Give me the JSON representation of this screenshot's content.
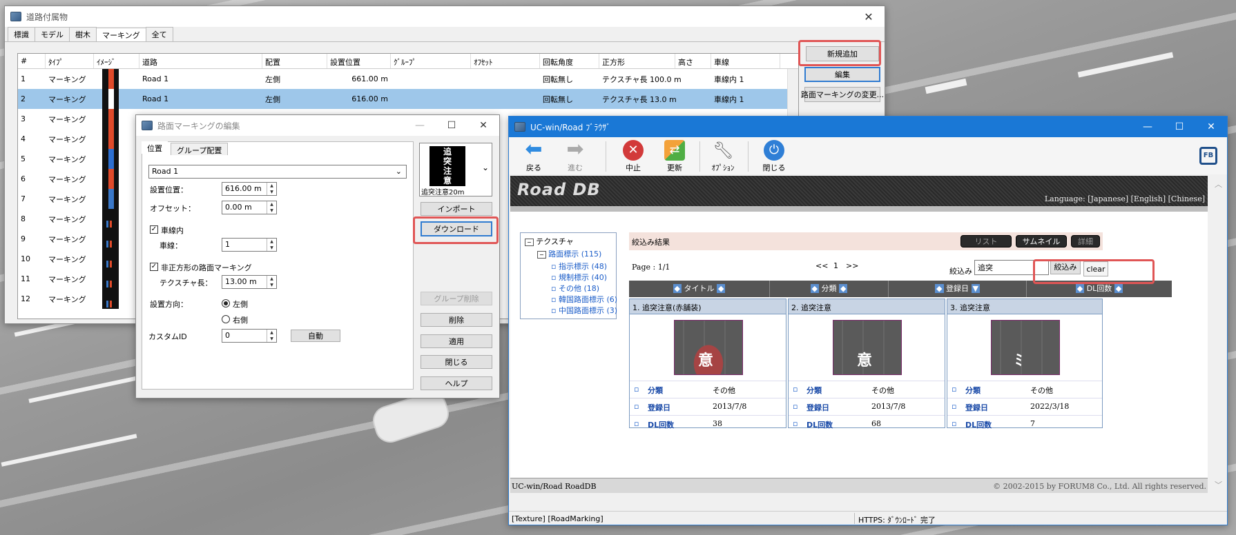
{
  "main_window": {
    "title": "道路付属物",
    "tabs": [
      "標識",
      "モデル",
      "樹木",
      "マーキング",
      "全て"
    ],
    "columns": [
      "#",
      "ﾀｲﾌﾟ",
      "ｲﾒｰｼﾞ",
      "道路",
      "配置",
      "設置位置",
      "ｸﾞﾙｰﾌﾟ",
      "ｵﾌｾｯﾄ",
      "回転角度",
      "正方形",
      "高さ",
      "車線"
    ],
    "rows": [
      {
        "num": "1",
        "type": "マーキング",
        "road": "Road 1",
        "place": "左側",
        "pos": "661.00 m",
        "rot": "回転無し",
        "square": "テクスチャ長 100.0 m",
        "lane": "車線内 1"
      },
      {
        "num": "2",
        "type": "マーキング",
        "road": "Road 1",
        "place": "左側",
        "pos": "616.00 m",
        "rot": "回転無し",
        "square": "テクスチャ長 13.0 m",
        "lane": "車線内 1"
      },
      {
        "num": "3",
        "type": "マーキング"
      },
      {
        "num": "4",
        "type": "マーキング"
      },
      {
        "num": "5",
        "type": "マーキング"
      },
      {
        "num": "6",
        "type": "マーキング"
      },
      {
        "num": "7",
        "type": "マーキング"
      },
      {
        "num": "8",
        "type": "マーキング"
      },
      {
        "num": "9",
        "type": "マーキング"
      },
      {
        "num": "10",
        "type": "マーキング"
      },
      {
        "num": "11",
        "type": "マーキング"
      },
      {
        "num": "12",
        "type": "マーキング"
      }
    ],
    "buttons": {
      "new": "新規追加",
      "edit": "編集",
      "change": "路面マーキングの変更..."
    }
  },
  "edit_dialog": {
    "title": "路面マーキングの編集",
    "tabs": [
      "位置",
      "グループ配置"
    ],
    "road": "Road 1",
    "pos_label": "設置位置：",
    "pos_value": "616.00 m",
    "offset_label": "オフセット：",
    "offset_value": "0.00 m",
    "in_lane_label": "車線内",
    "lane_label": "車線：",
    "lane_value": "1",
    "non_square_label": "非正方形の路面マーキング",
    "tex_label": "テクスチャ長：",
    "tex_value": "13.00 m",
    "dir_label": "設置方向：",
    "left_label": "左側",
    "right_label": "右側",
    "custom_label": "カスタムID",
    "custom_value": "0",
    "auto_btn": "自動",
    "preview_chars": [
      "追",
      "突",
      "注",
      "意"
    ],
    "preview_caption": "追突注意20m",
    "import_btn": "インポート",
    "download_btn": "ダウンロード",
    "group_delete_btn": "グループ削除",
    "delete_btn": "削除",
    "apply_btn": "適用",
    "close_btn": "閉じる",
    "help_btn": "ヘルプ"
  },
  "browser": {
    "title": "UC-win/Road  ﾌﾞﾗｳｻﾞ",
    "toolbar": [
      {
        "label": "戻る",
        "icon": "back-arrow-icon"
      },
      {
        "label": "進む",
        "icon": "forward-arrow-icon"
      },
      {
        "label": "中止",
        "icon": "stop-icon"
      },
      {
        "label": "更新",
        "icon": "refresh-icon"
      },
      {
        "label": "ｵﾌﾟｼｮﾝ",
        "icon": "wrench-icon"
      },
      {
        "label": "閉じる",
        "icon": "power-icon"
      }
    ],
    "banner": "Road DB",
    "language": "Language: [Japanese]  [English]  [Chinese]",
    "tree": {
      "root": "テクスチャ",
      "group": "路面標示 (115)",
      "items": [
        "指示標示 (48)",
        "規制標示 (40)",
        "その他 (18)",
        "韓国路面標示 (6)",
        "中国路面標示 (3)"
      ]
    },
    "results_title": "絞込み結果",
    "view_btns": [
      "リスト",
      "サムネイル",
      "詳細"
    ],
    "page": "Page : 1/1",
    "pager": [
      "<<",
      "1",
      ">>"
    ],
    "filter_label": "絞込み",
    "filter_value": "追突",
    "filter_btn": "絞込み",
    "clear_btn": "clear",
    "sort_cols": [
      "タイトル",
      "分類",
      "登録日",
      "DL回数"
    ],
    "cards": [
      {
        "title": "1. 追突注意(赤舗装)",
        "cat_label": "分類",
        "cat": "その他",
        "date_label": "登録日",
        "date": "2013/7/8",
        "dl_label": "DL回数",
        "dl": "38"
      },
      {
        "title": "2. 追突注意",
        "cat_label": "分類",
        "cat": "その他",
        "date_label": "登録日",
        "date": "2013/7/8",
        "dl_label": "DL回数",
        "dl": "68"
      },
      {
        "title": "3. 追突注意",
        "cat_label": "分類",
        "cat": "その他",
        "date_label": "登録日",
        "date": "2022/3/18",
        "dl_label": "DL回数",
        "dl": "7"
      }
    ],
    "footer_left": "UC-win/Road RoadDB",
    "footer_right": "© 2002-2015 by FORUM8 Co., Ltd. All rights reserved.",
    "status_left": "[Texture] [RoadMarking]",
    "status_right": "HTTPS: ﾀﾞｳﾝﾛｰﾄﾞ 完了"
  }
}
